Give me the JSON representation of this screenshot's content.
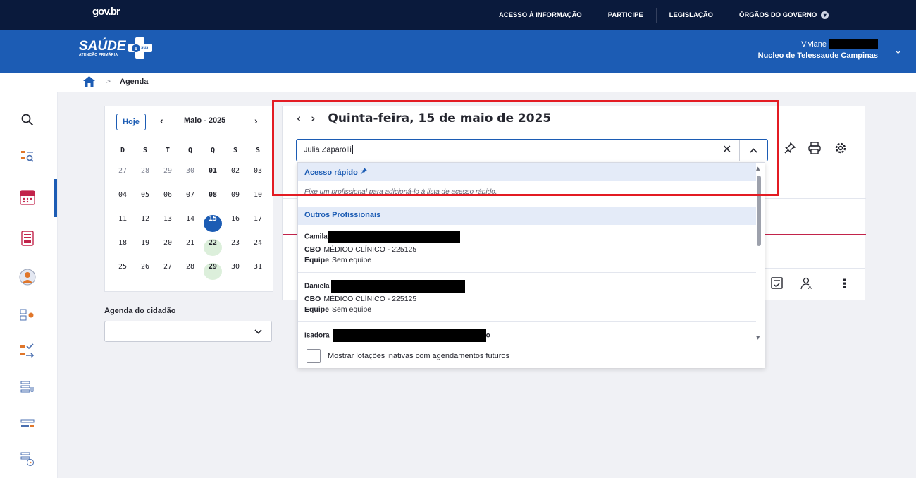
{
  "gov": {
    "logo": "gov.br",
    "links": [
      "ACESSO À INFORMAÇÃO",
      "PARTICIPE",
      "LEGISLAÇÃO",
      "ÓRGÃOS DO GOVERNO"
    ]
  },
  "header": {
    "brand": "SAÚDE",
    "brand_sub": "ATENÇÃO PRIMÁRIA",
    "esus_e": "e",
    "esus_sus": "sus",
    "user_name": "Viviane",
    "user_unit": "Nucleo de Telessaude Campinas"
  },
  "breadcrumb": {
    "current": "Agenda"
  },
  "calendar": {
    "today_button": "Hoje",
    "month_label": "Maio - 2025",
    "weekdays": [
      "D",
      "S",
      "T",
      "Q",
      "Q",
      "S",
      "S"
    ],
    "weeks": [
      [
        "27",
        "28",
        "29",
        "30",
        "01",
        "02",
        "03"
      ],
      [
        "04",
        "05",
        "06",
        "07",
        "08",
        "09",
        "10"
      ],
      [
        "11",
        "12",
        "13",
        "14",
        "15",
        "16",
        "17"
      ],
      [
        "18",
        "19",
        "20",
        "21",
        "22",
        "23",
        "24"
      ],
      [
        "25",
        "26",
        "27",
        "28",
        "29",
        "30",
        "31"
      ]
    ],
    "selected_day": "15",
    "highlighted_days": [
      "22",
      "29"
    ]
  },
  "citizen_agenda": {
    "label": "Agenda do cidadão",
    "value": ""
  },
  "day_view": {
    "title": "Quinta-feira, 15 de maio de 2025"
  },
  "professional_search": {
    "value": "Julia Zaparolli",
    "quick_access_header": "Acesso rápido",
    "quick_access_hint": "Fixe um profissional para adicioná-lo à lista de acesso rápido.",
    "others_header": "Outros Profissionais",
    "professionals": [
      {
        "name": "Camila",
        "cbo_label": "CBO",
        "cbo_value": "MÉDICO CLÍNICO - 225125",
        "team_label": "Equipe",
        "team_value": "Sem equipe"
      },
      {
        "name": "Daniela",
        "cbo_label": "CBO",
        "cbo_value": "MÉDICO CLÍNICO - 225125",
        "team_label": "Equipe",
        "team_value": "Sem equipe"
      },
      {
        "name": "Isadora",
        "name_suffix": "o"
      }
    ],
    "inactive_checkbox_label": "Mostrar lotações inativas com agendamentos futuros"
  },
  "colors": {
    "gov_bar": "#0a1a3c",
    "header": "#1c5cb4",
    "highlight_box": "#e31b23",
    "selected_day": "#1c5cb4"
  }
}
